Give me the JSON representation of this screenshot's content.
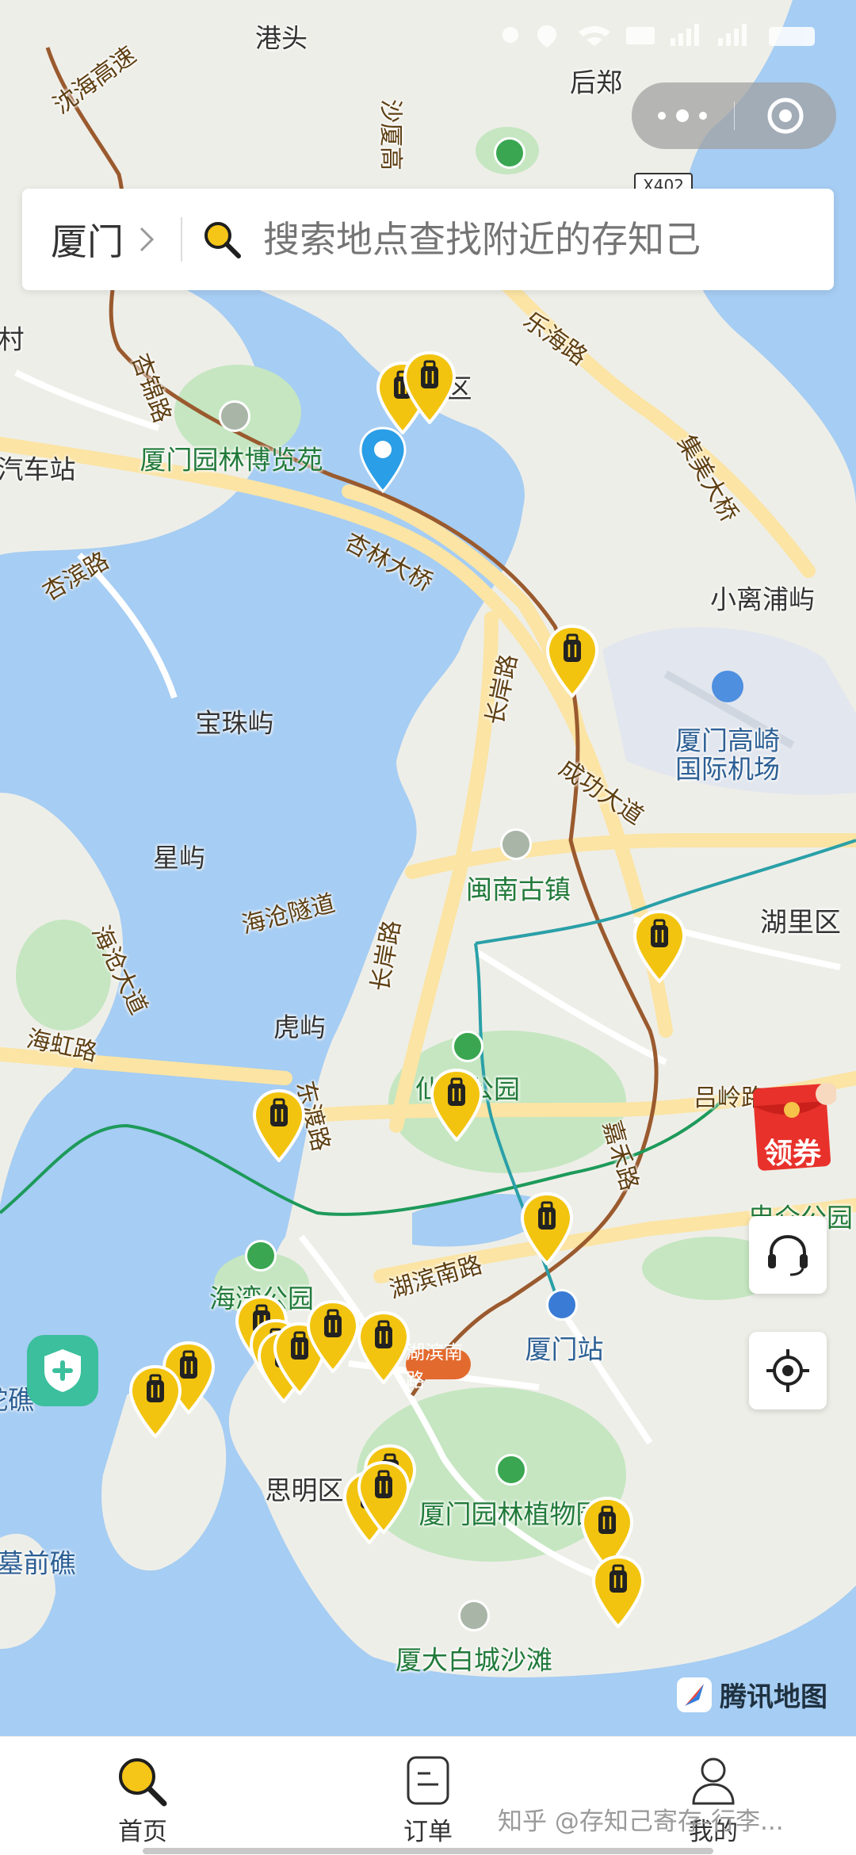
{
  "status_bar": {
    "left": "",
    "right_icons": [
      "alarm-icon",
      "location-icon",
      "wifi-icon",
      "hd-icon",
      "signal-icon",
      "battery-icon"
    ]
  },
  "map": {
    "labels": [
      {
        "text": "港头",
        "kind": "place"
      },
      {
        "text": "后郑",
        "kind": "place"
      },
      {
        "text": "沈海高速",
        "kind": "road"
      },
      {
        "text": "沙厦高",
        "kind": "road"
      },
      {
        "text": "X402",
        "kind": "shield"
      },
      {
        "text": "村",
        "kind": "place"
      },
      {
        "text": "杏锦路",
        "kind": "road"
      },
      {
        "text": "集美区",
        "kind": "place"
      },
      {
        "text": "乐海路",
        "kind": "road"
      },
      {
        "text": "集美大桥",
        "kind": "road"
      },
      {
        "text": "汽车站",
        "kind": "place"
      },
      {
        "text": "厦门园林博览苑",
        "kind": "park"
      },
      {
        "text": "杏林大桥",
        "kind": "road"
      },
      {
        "text": "杏滨路",
        "kind": "road"
      },
      {
        "text": "小离浦屿",
        "kind": "place"
      },
      {
        "text": "长岸路",
        "kind": "road"
      },
      {
        "text": "宝珠屿",
        "kind": "place"
      },
      {
        "text": "厦门高崎",
        "kind": "water"
      },
      {
        "text": "国际机场",
        "kind": "water"
      },
      {
        "text": "成功大道",
        "kind": "road"
      },
      {
        "text": "星屿",
        "kind": "place"
      },
      {
        "text": "闽南古镇",
        "kind": "park"
      },
      {
        "text": "海沧隧道",
        "kind": "road"
      },
      {
        "text": "湖里区",
        "kind": "place"
      },
      {
        "text": "海沧大道",
        "kind": "road"
      },
      {
        "text": "长岸路",
        "kind": "road"
      },
      {
        "text": "海虹路",
        "kind": "road"
      },
      {
        "text": "虎屿",
        "kind": "place"
      },
      {
        "text": "仙岳公园",
        "kind": "park"
      },
      {
        "text": "吕岭路",
        "kind": "road"
      },
      {
        "text": "嘉禾路",
        "kind": "road"
      },
      {
        "text": "东渡路",
        "kind": "road"
      },
      {
        "text": "忠仑公园",
        "kind": "park"
      },
      {
        "text": "海湾公园",
        "kind": "park"
      },
      {
        "text": "湖滨南路",
        "kind": "road"
      },
      {
        "text": "厦门站",
        "kind": "water"
      },
      {
        "text": "1号线",
        "kind": "metro"
      },
      {
        "text": "鸵礁",
        "kind": "water"
      },
      {
        "text": "思明区",
        "kind": "place"
      },
      {
        "text": "厦门园林植物园",
        "kind": "park"
      },
      {
        "text": "墓前礁",
        "kind": "water"
      },
      {
        "text": "厦大白城沙滩",
        "kind": "park"
      }
    ],
    "storage_pins_count": 20
  },
  "capsule": {
    "more_icon": "more-dots-icon",
    "close_icon": "target-close-icon"
  },
  "search": {
    "city": "厦门",
    "placeholder": "搜索地点查找附近的存知己"
  },
  "controls": {
    "coupon_label": "领券",
    "service_icon": "headset-icon",
    "locate_icon": "locate-icon",
    "security_icon": "shield-plus-icon"
  },
  "map_provider": {
    "name": "腾讯地图"
  },
  "tabbar": {
    "tabs": [
      {
        "label": "首页",
        "icon": "search-icon",
        "active": true
      },
      {
        "label": "订单",
        "icon": "order-icon",
        "active": false
      },
      {
        "label": "我的",
        "icon": "user-icon",
        "active": false
      }
    ]
  },
  "watermark": "知乎 @存知己寄存-行李..."
}
